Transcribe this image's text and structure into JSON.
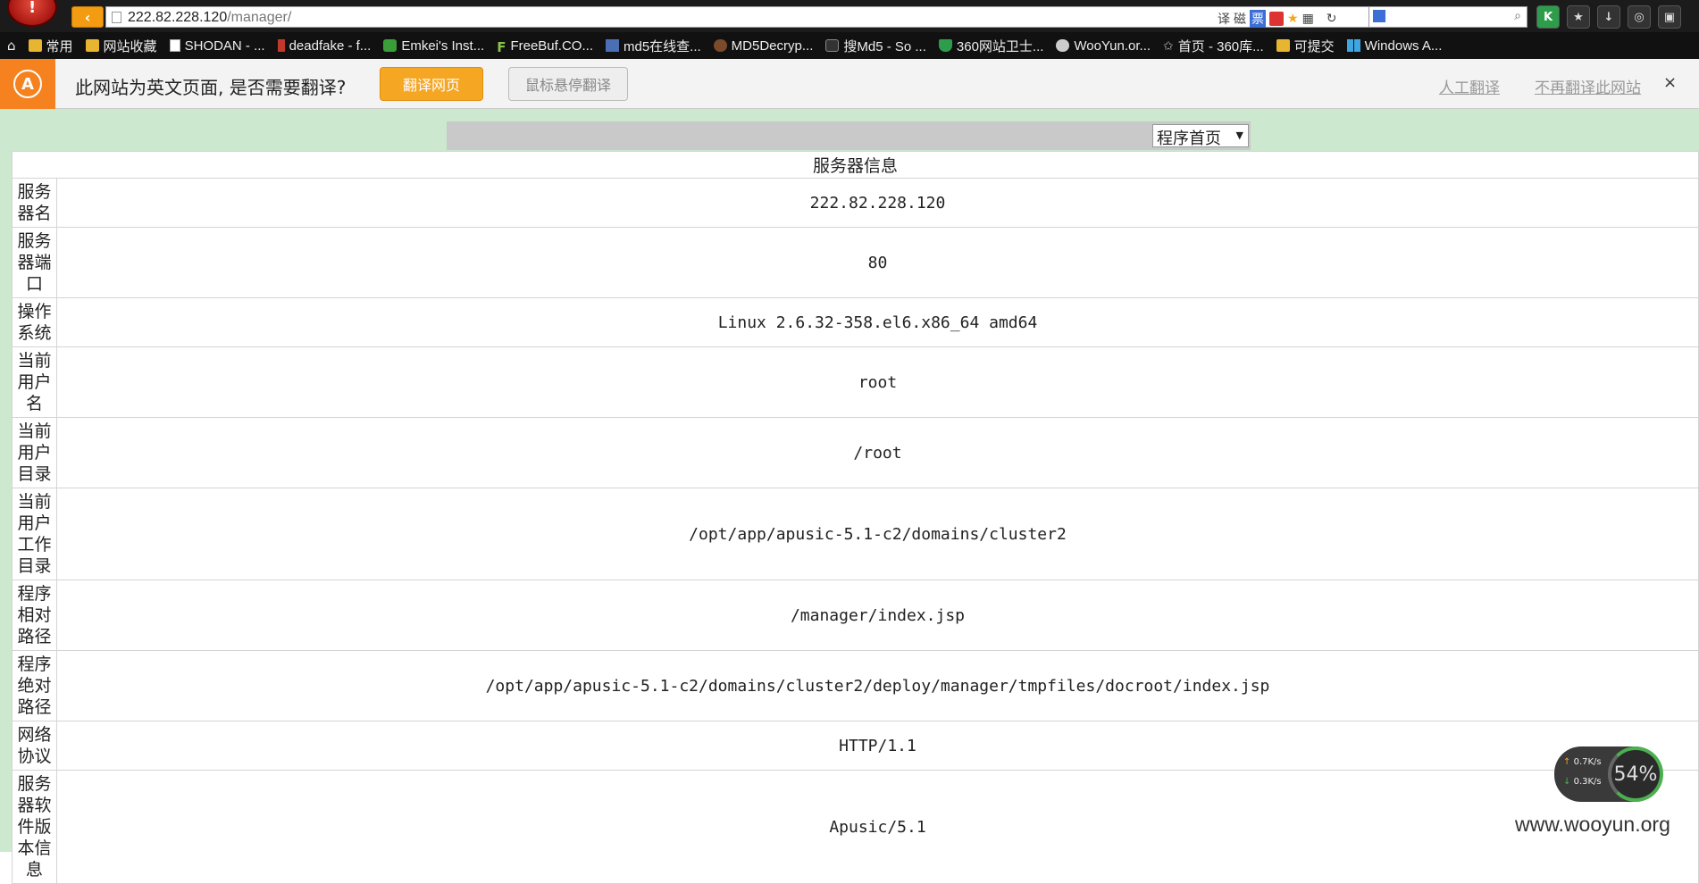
{
  "browser": {
    "url_host": "222.82.228.120",
    "url_path": "/manager/",
    "bookmarks": [
      {
        "label": "常用",
        "icon": "folder-icon"
      },
      {
        "label": "网站收藏",
        "icon": "folder-icon"
      },
      {
        "label": "SHODAN - ...",
        "icon": "page-icon"
      },
      {
        "label": "deadfake - f...",
        "icon": "red-bar-icon"
      },
      {
        "label": "Emkei's Inst...",
        "icon": "green-icon"
      },
      {
        "label": "FreeBuf.CO...",
        "icon": "freebuf-icon"
      },
      {
        "label": "md5在线查...",
        "icon": "grid-icon"
      },
      {
        "label": "MD5Decryp...",
        "icon": "dark-icon"
      },
      {
        "label": "搜Md5 - So ...",
        "icon": "somd5-icon"
      },
      {
        "label": "360网站卫士...",
        "icon": "shield-icon"
      },
      {
        "label": "WooYun.or...",
        "icon": "cloud-icon"
      },
      {
        "label": "首页 - 360库...",
        "icon": "star-icon"
      },
      {
        "label": "可提交",
        "icon": "folder-icon"
      },
      {
        "label": "Windows A...",
        "icon": "windows-icon"
      }
    ],
    "addr_tools": [
      "译",
      "磁",
      "票"
    ]
  },
  "translate_bar": {
    "message": "此网站为英文页面, 是否需要翻译?",
    "translate_button": "翻译网页",
    "hover_button": "鼠标悬停翻译",
    "manual_link": "人工翻译",
    "never_link": "不再翻译此网站",
    "close": "×"
  },
  "page": {
    "select_value": "程序首页",
    "table_title": "服务器信息",
    "rows": [
      {
        "key": "服务器名",
        "value": "222.82.228.120"
      },
      {
        "key": "服务器端口",
        "value": "80"
      },
      {
        "key": "操作系统",
        "value": "Linux 2.6.32-358.el6.x86_64 amd64"
      },
      {
        "key": "当前用户名",
        "value": "root"
      },
      {
        "key": "当前用户目录",
        "value": "/root"
      },
      {
        "key": "当前用户工作目录",
        "value": "/opt/app/apusic-5.1-c2/domains/cluster2"
      },
      {
        "key": "程序相对路径",
        "value": "/manager/index.jsp"
      },
      {
        "key": "程序绝对路径",
        "value": "/opt/app/apusic-5.1-c2/domains/cluster2/deploy/manager/tmpfiles/docroot/index.jsp"
      },
      {
        "key": "网络协议",
        "value": "HTTP/1.1"
      },
      {
        "key": "服务器软件版本信息",
        "value": "Apusic/5.1"
      }
    ]
  },
  "net_widget": {
    "up": "0.7K/s",
    "down": "0.3K/s",
    "percent": "54%"
  },
  "watermark": "www.wooyun.org"
}
